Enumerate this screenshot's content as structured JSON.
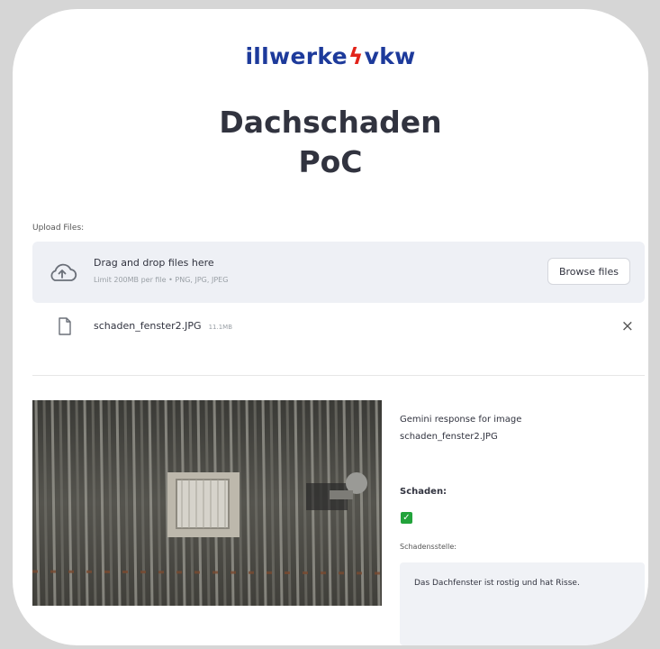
{
  "logo": {
    "left": "illwerke",
    "bolt": "ϟ",
    "right": "vkw"
  },
  "title": {
    "line1": "Dachschaden",
    "line2": "PoC"
  },
  "uploader": {
    "label": "Upload Files:",
    "drag_text": "Drag and drop files here",
    "limit_text": "Limit 200MB per file • PNG, JPG, JPEG",
    "browse_label": "Browse files"
  },
  "file": {
    "name": "schaden_fenster2.JPG",
    "size": "11.1MB",
    "remove_glyph": "×"
  },
  "response": {
    "label_line1": "Gemini response for image",
    "label_line2": "schaden_fenster2.JPG",
    "schaden_heading": "Schaden:",
    "schaden_checked": true,
    "check_glyph": "✓",
    "stelle_label": "Schadensstelle:",
    "stelle_text": "Das Dachfenster ist rostig und hat Risse."
  },
  "colors": {
    "logo_blue": "#1d3a9b",
    "logo_red": "#e2231a",
    "checkbox_green": "#22a33b",
    "dropzone_bg": "#eef0f5"
  },
  "icons": [
    "cloud-upload-icon",
    "file-icon",
    "close-icon",
    "checkbox-checked-icon"
  ]
}
